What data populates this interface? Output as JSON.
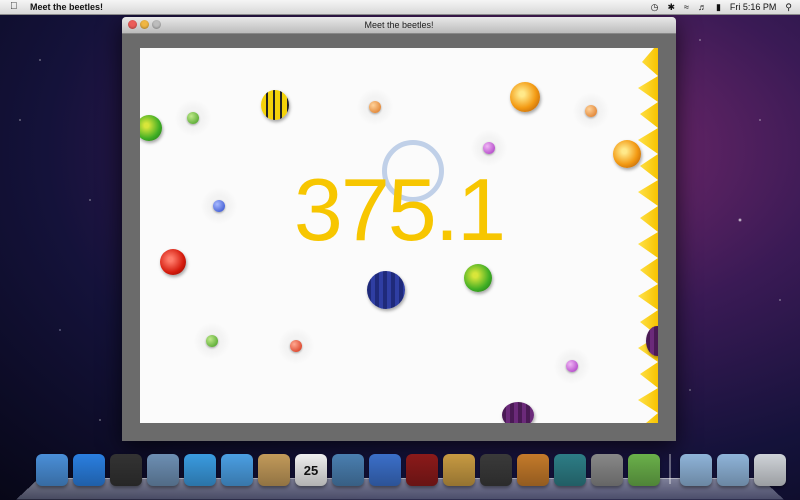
{
  "menubar": {
    "app_name": "Meet the beetles!",
    "clock": "Fri 5:16 PM"
  },
  "window": {
    "title": "Meet the beetles!"
  },
  "game": {
    "score": "375.1"
  },
  "dock": {
    "items": [
      {
        "name": "finder-icon",
        "color": "#4a8fd8"
      },
      {
        "name": "app-store-icon",
        "color": "#2a7fe0"
      },
      {
        "name": "dashboard-icon",
        "color": "#333"
      },
      {
        "name": "mail-icon",
        "color": "#6d8fb3"
      },
      {
        "name": "safari-icon",
        "color": "#3a9be0"
      },
      {
        "name": "ichat-icon",
        "color": "#4b9fe3"
      },
      {
        "name": "address-book-icon",
        "color": "#c29a5a"
      },
      {
        "name": "ical-icon",
        "color": "#eee",
        "label": "25"
      },
      {
        "name": "iphoto-icon",
        "color": "#4a7fb0"
      },
      {
        "name": "itunes-icon",
        "color": "#3b6fc9"
      },
      {
        "name": "front-row-icon",
        "color": "#8b1a1a"
      },
      {
        "name": "photo-booth-icon",
        "color": "#c79a42"
      },
      {
        "name": "imovie-icon",
        "color": "#3a3a3a"
      },
      {
        "name": "garageband-icon",
        "color": "#c47a2a"
      },
      {
        "name": "time-machine-icon",
        "color": "#2d7d86"
      },
      {
        "name": "system-preferences-icon",
        "color": "#888"
      },
      {
        "name": "meet-the-beetles-icon",
        "color": "#6ab04a"
      }
    ],
    "right_items": [
      {
        "name": "applications-folder-icon",
        "color": "#8fb4d9"
      },
      {
        "name": "documents-folder-icon",
        "color": "#8fb4d9"
      },
      {
        "name": "trash-icon",
        "color": "#cfd3d8"
      }
    ]
  }
}
